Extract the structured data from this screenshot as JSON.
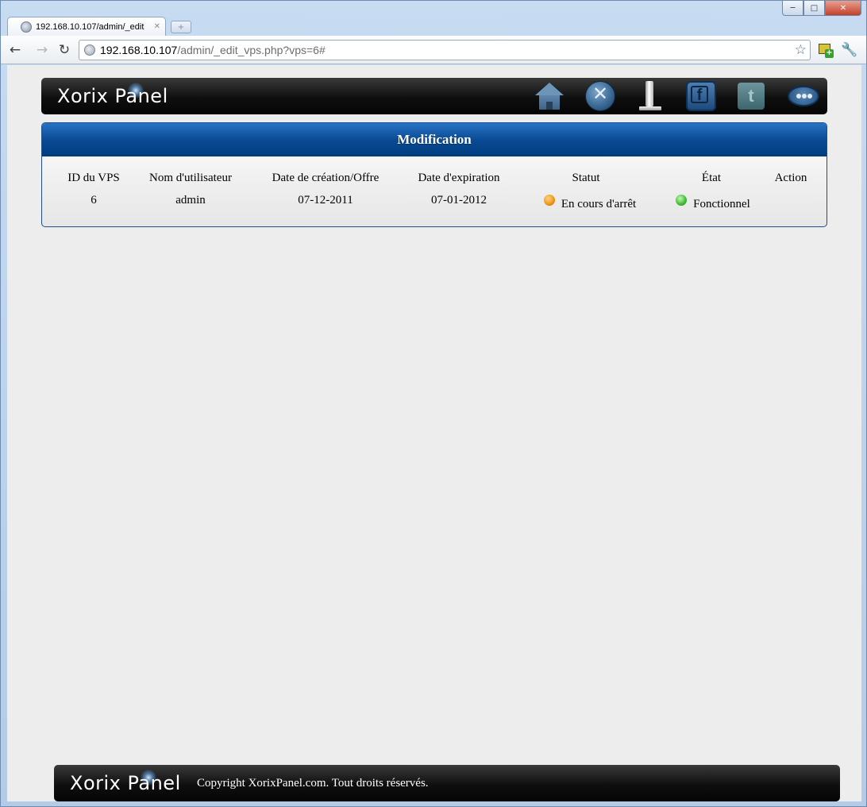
{
  "browser": {
    "tab_title": "192.168.10.107/admin/_edit",
    "url_host": "192.168.10.107",
    "url_path": "/admin/_edit_vps.php?vps=6#"
  },
  "header": {
    "logo": "Xorix Panel"
  },
  "panel": {
    "title": "Modification",
    "columns": [
      "ID du VPS",
      "Nom d'utilisateur",
      "Date de création/Offre",
      "Date d'expiration",
      "Statut",
      "État",
      "Action"
    ],
    "row": {
      "id": "6",
      "username": "admin",
      "created": "07-12-2011",
      "expires": "07-01-2012",
      "status": "En cours d'arrêt",
      "state": "Fonctionnel",
      "action": ""
    },
    "status_color": "#f29a1b",
    "state_color": "#44c13a"
  },
  "footer": {
    "logo": "Xorix Panel",
    "copyright": "Copyright XorixPanel.com. Tout droits réservés."
  }
}
